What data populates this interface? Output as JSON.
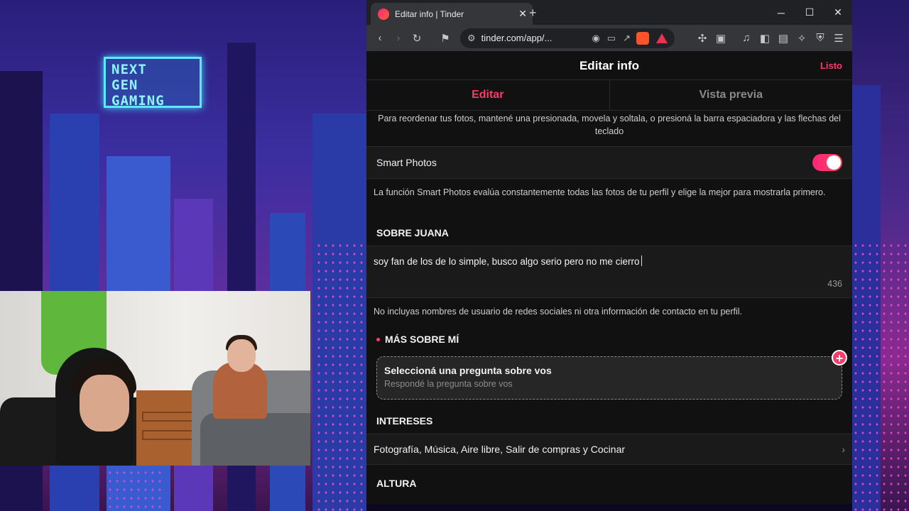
{
  "wallpaper": {
    "neon_sign": [
      "NEXT",
      "GEN",
      "GAMING"
    ]
  },
  "browser": {
    "tab_title": "Editar info | Tinder",
    "url": "tinder.com/app/...",
    "window_controls": [
      "minimize-icon",
      "maximize-icon",
      "close-icon"
    ]
  },
  "page": {
    "header_title": "Editar info",
    "done_label": "Listo",
    "tabs": [
      {
        "label": "Editar",
        "active": true
      },
      {
        "label": "Vista previa",
        "active": false
      }
    ],
    "reorder_hint": "Para reordenar tus fotos, mantené una presionada, movela y soltala, o presioná la barra espaciadora y las flechas del teclado",
    "smart_photos": {
      "label": "Smart Photos",
      "enabled": true,
      "description": "La función Smart Photos evalúa constantemente todas las fotos de tu perfil y elige la mejor para mostrarla primero."
    },
    "about": {
      "heading": "SOBRE JUANA",
      "text": "soy fan de los de lo simple, busco algo serio pero no me cierro",
      "remaining_chars": "436"
    },
    "contact_warning": "No incluyas nombres de usuario de redes sociales ni otra información de contacto en tu perfil.",
    "more_about_me": {
      "heading": "MÁS SOBRE MÍ",
      "question_title": "Seleccioná una pregunta sobre vos",
      "question_subtitle": "Respondé la pregunta sobre vos"
    },
    "interests": {
      "heading": "INTERESES",
      "value": "Fotografía, Música, Aire libre, Salir de compras y Cocinar"
    },
    "height_heading": "ALTURA"
  },
  "colors": {
    "accent": "#fd3a69",
    "background": "#111111",
    "row": "#1a1a1a"
  }
}
